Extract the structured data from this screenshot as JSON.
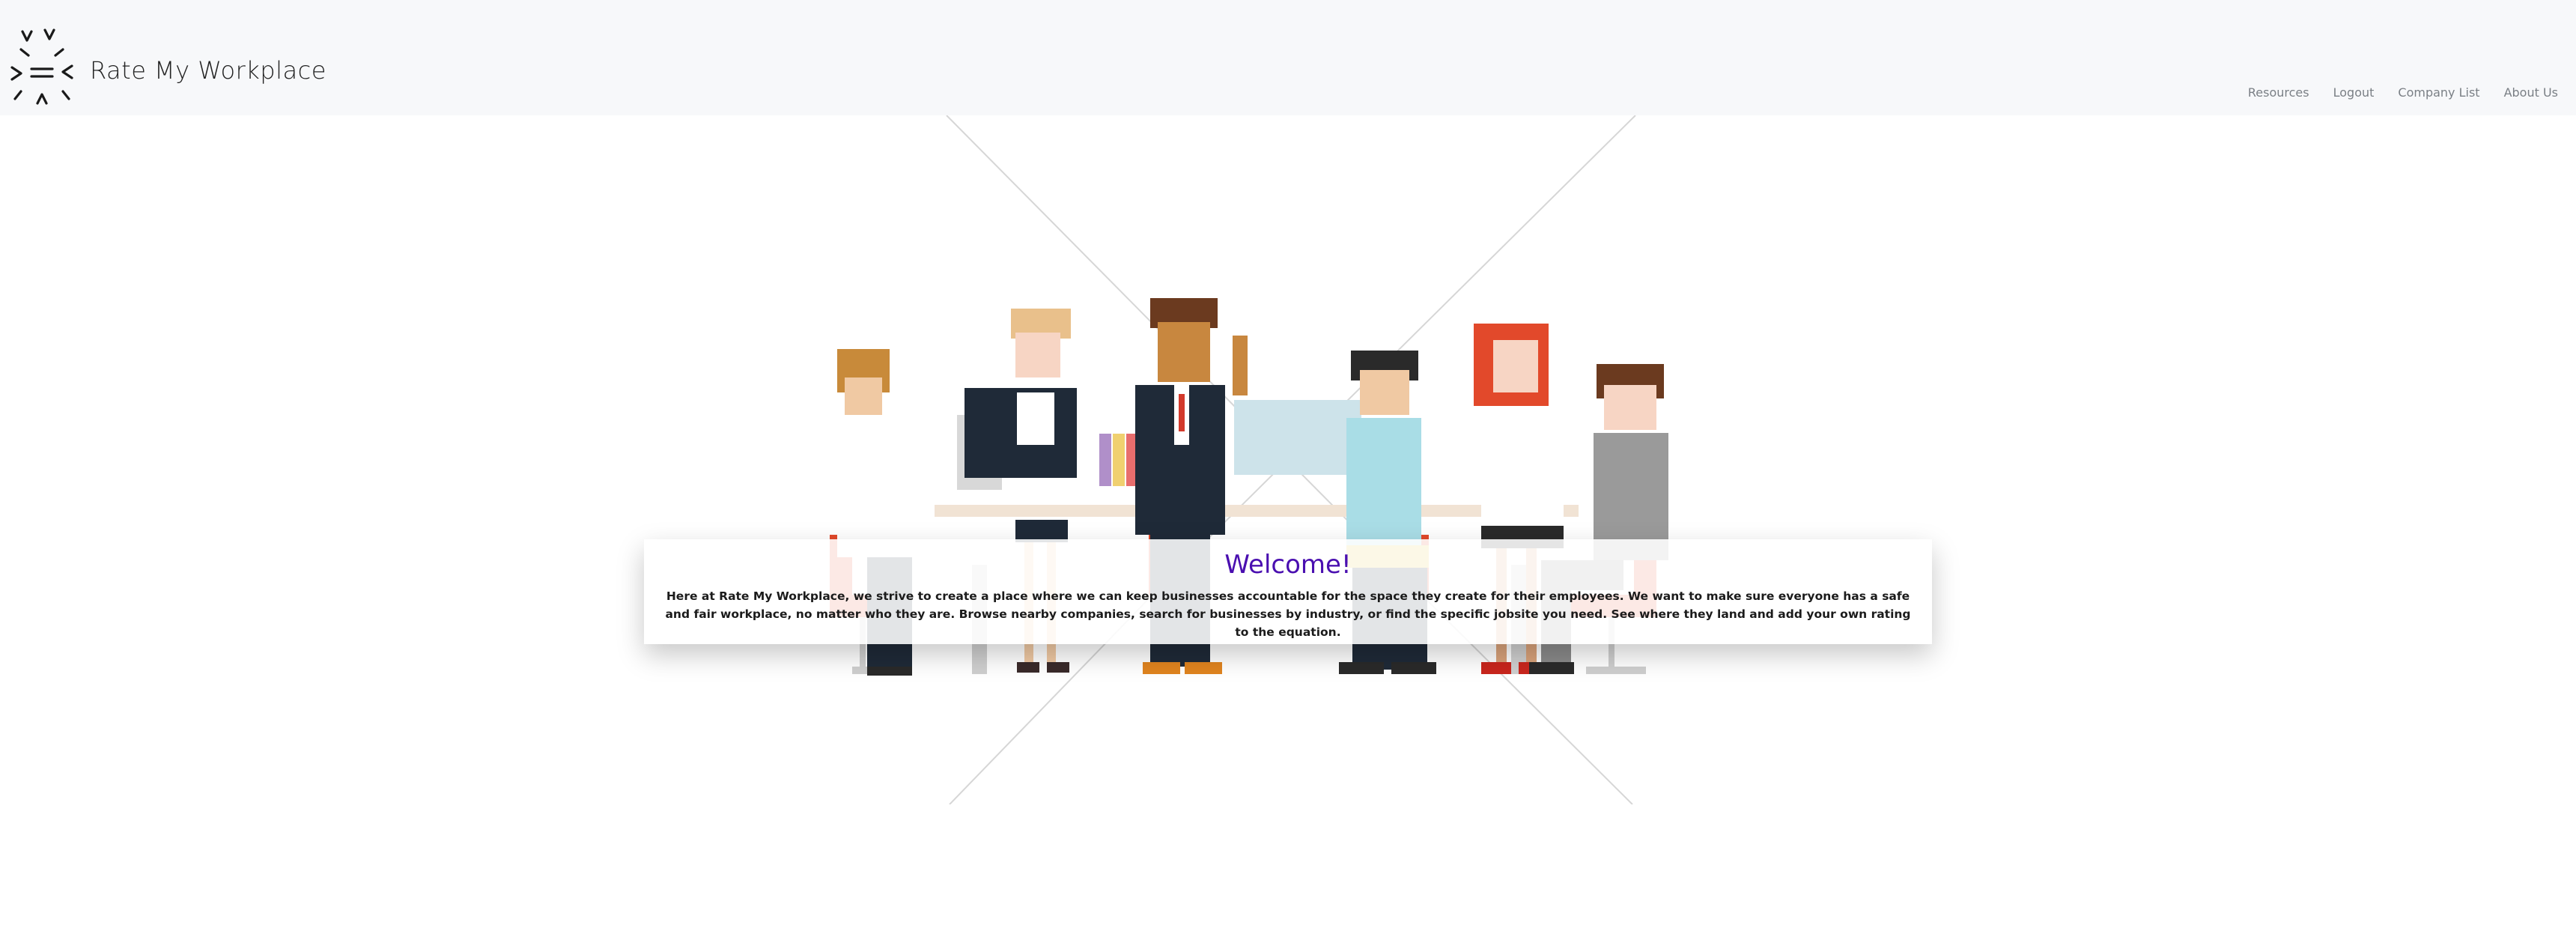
{
  "navbar": {
    "brand_name": "Rate My Workplace",
    "logo_icon": "starburst-logo-icon",
    "links": [
      {
        "label": "Resources"
      },
      {
        "label": "Logout"
      },
      {
        "label": "Company List"
      },
      {
        "label": "About Us"
      }
    ]
  },
  "hero": {
    "illustration": "pixel-art-office-team-illustration",
    "welcome_title": "Welcome!",
    "welcome_text": "Here at Rate My Workplace, we strive to create a place where we can keep businesses accountable for the space they create for their employees. We want to make sure everyone has a safe and fair workplace, no matter who they are. Browse nearby companies, search for businesses by industry, or find the specific jobsite you need. See where they land and add your own rating to the equation."
  },
  "colors": {
    "navbar_bg": "#f7f8fa",
    "nav_link": "#7a7f85",
    "welcome_title": "#4a0fb0",
    "body_text": "#1b1b1b"
  }
}
